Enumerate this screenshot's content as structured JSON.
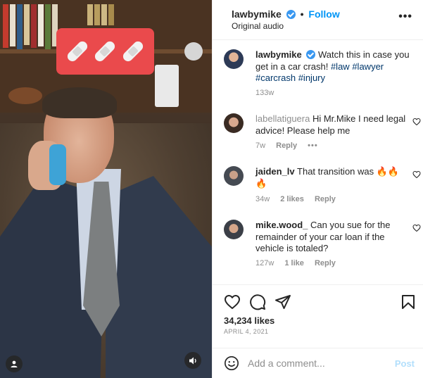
{
  "header": {
    "username": "lawbymike",
    "separator": "•",
    "follow_label": "Follow",
    "audio": "Original audio",
    "more_icon": "more-horizontal-icon"
  },
  "caption": {
    "username": "lawbymike",
    "text": "Watch this in case you get in a car crash!",
    "hashtags": [
      "#law",
      "#lawyer",
      "#carcrash",
      "#injury"
    ],
    "time": "133w"
  },
  "comments": [
    {
      "username": "labellatiguera",
      "text": "Hi Mr.Mike I need legal advice! Please help me",
      "time": "7w",
      "likes": "",
      "reply": "Reply",
      "options": "•••"
    },
    {
      "username": "jaiden_lv",
      "text": "That transition was 🔥🔥🔥",
      "time": "34w",
      "likes": "2 likes",
      "reply": "Reply",
      "options": ""
    },
    {
      "username": "mike.wood_",
      "text": "Can you sue for the remainder of your car loan if the vehicle is totaled?",
      "time": "127w",
      "likes": "1 like",
      "reply": "Reply",
      "options": ""
    }
  ],
  "actions": {
    "like_icon": "heart-icon",
    "comment_icon": "comment-icon",
    "share_icon": "send-icon",
    "save_icon": "bookmark-icon",
    "likes": "34,234 likes",
    "date": "APRIL 4, 2021"
  },
  "composer": {
    "emoji_icon": "emoji-icon",
    "placeholder": "Add a comment...",
    "post_label": "Post"
  },
  "colors": {
    "accent": "#0095f6",
    "post_disabled": "#b2dffc",
    "sticker": "#ea4a4c",
    "hashtag": "#00376b"
  }
}
